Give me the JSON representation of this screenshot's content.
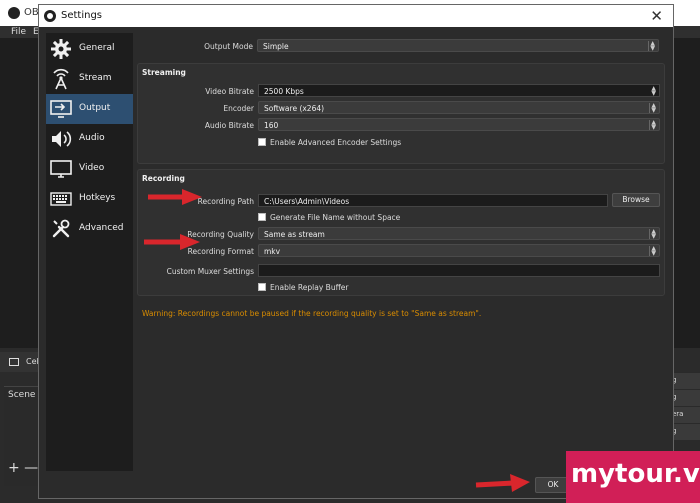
{
  "background": {
    "window_title": "OBS",
    "menu": [
      "File",
      "E"
    ],
    "scenes_bar_label": "Cel",
    "scene_header": "Scene",
    "add_glyph": "+ —",
    "right_panel_items": [
      "g",
      "g",
      "era",
      "g"
    ]
  },
  "dialog": {
    "title": "Settings",
    "close_glyph": "✕"
  },
  "sidebar": {
    "items": [
      {
        "label": "General",
        "icon": "gear-icon"
      },
      {
        "label": "Stream",
        "icon": "antenna-icon"
      },
      {
        "label": "Output",
        "icon": "monitor-output-icon"
      },
      {
        "label": "Audio",
        "icon": "speaker-icon"
      },
      {
        "label": "Video",
        "icon": "monitor-icon"
      },
      {
        "label": "Hotkeys",
        "icon": "keyboard-icon"
      },
      {
        "label": "Advanced",
        "icon": "tools-icon"
      }
    ],
    "active": "Output"
  },
  "output": {
    "output_mode_label": "Output Mode",
    "output_mode_value": "Simple"
  },
  "streaming": {
    "title": "Streaming",
    "video_bitrate_label": "Video Bitrate",
    "video_bitrate_value": "2500 Kbps",
    "encoder_label": "Encoder",
    "encoder_value": "Software (x264)",
    "audio_bitrate_label": "Audio Bitrate",
    "audio_bitrate_value": "160",
    "advanced_encoder_label": "Enable Advanced Encoder Settings"
  },
  "recording": {
    "title": "Recording",
    "path_label": "Recording Path",
    "path_value": "C:\\Users\\Admin\\Videos",
    "browse_label": "Browse",
    "no_space_label": "Generate File Name without Space",
    "quality_label": "Recording Quality",
    "quality_value": "Same as stream",
    "format_label": "Recording Format",
    "format_value": "mkv",
    "muxer_label": "Custom Muxer Settings",
    "muxer_value": "",
    "replay_buffer_label": "Enable Replay Buffer"
  },
  "warning": "Warning: Recordings cannot be paused if the recording quality is set to \"Same as stream\".",
  "buttons": {
    "ok": "OK"
  },
  "watermark": "mytour.vn",
  "colors": {
    "active_nav": "#2d4f71",
    "warning": "#d98c00",
    "arrow": "#d9262c",
    "watermark_bg": "#d11f57"
  }
}
